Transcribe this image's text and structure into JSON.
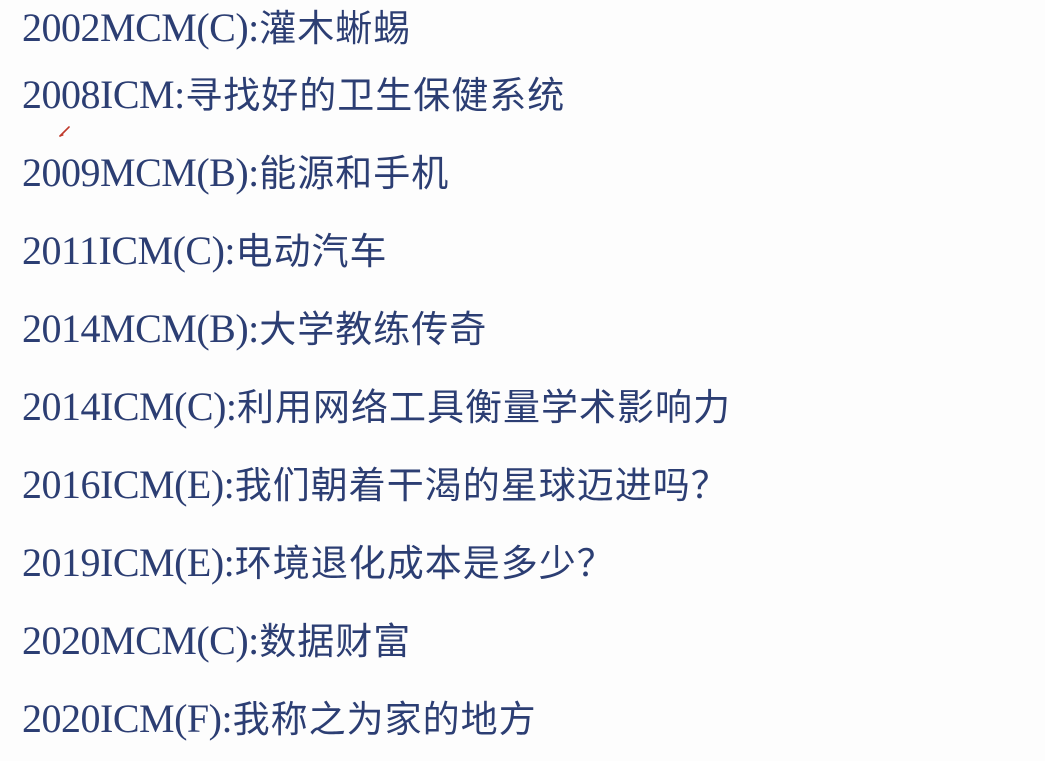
{
  "items": [
    {
      "code": "2002MCM(C)",
      "sep": ":",
      "title": "灌木蜥蜴"
    },
    {
      "code": "2008ICM",
      "sep": ":",
      "title": "寻找好的卫生保健系统"
    },
    {
      "code": "2009MCM(B)",
      "sep": ":",
      "title": "能源和手机"
    },
    {
      "code": "2011ICM(C)",
      "sep": ":",
      "title": "电动汽车"
    },
    {
      "code": "2014MCM(B)",
      "sep": ":",
      "title": "大学教练传奇"
    },
    {
      "code": "2014ICM(C)",
      "sep": ":",
      "title": "利用网络工具衡量学术影响力"
    },
    {
      "code": "2016ICM(E)",
      "sep": ":",
      "title": "我们朝着干渴的星球迈进吗？"
    },
    {
      "code": "2019ICM(E)",
      "sep": ":",
      "title": "环境退化成本是多少？"
    },
    {
      "code": "2020MCM(C)",
      "sep": ":",
      "title": "数据财富"
    },
    {
      "code": "2020ICM(F)",
      "sep": ":",
      "title": "我称之为家的地方"
    }
  ],
  "colors": {
    "text": "#2c3e73",
    "background": "#fdfdfd",
    "pen_mark": "#c0392b"
  },
  "icons": {
    "pen_mark": "pen-annotation-mark-icon"
  }
}
